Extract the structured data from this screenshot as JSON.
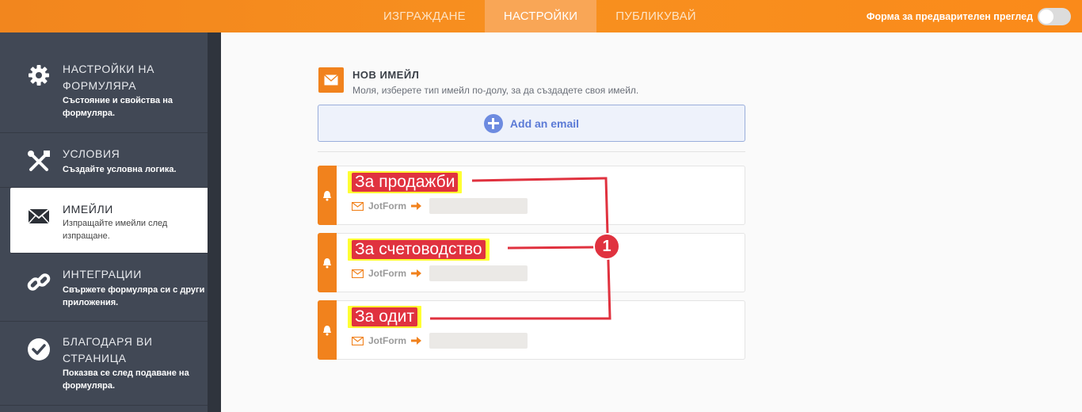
{
  "topbar": {
    "tabs": [
      {
        "label": "ИЗГРАЖДАНЕ",
        "active": false
      },
      {
        "label": "НАСТРОЙКИ",
        "active": true
      },
      {
        "label": "ПУБЛИКУВАЙ",
        "active": false
      }
    ],
    "preview_label": "Форма за предварителен преглед",
    "preview_on": false
  },
  "sidebar": {
    "items": [
      {
        "icon": "gear-icon",
        "title_line1": "НАСТРОЙКИ НА",
        "title_line2": "ФОРМУЛЯРА",
        "desc_line1": "Състояние и свойства на",
        "desc_line2": "формуляра."
      },
      {
        "icon": "tools-icon",
        "title_line1": "УСЛОВИЯ",
        "desc_line1": "Създайте условна логика."
      },
      {
        "icon": "envelope-icon",
        "title_line1": "ИМЕЙЛИ",
        "desc_line1": "Изпращайте имейли след",
        "desc_line2": "изпращане.",
        "active": true
      },
      {
        "icon": "link-icon",
        "title_line1": "ИНТЕГРАЦИИ",
        "desc_line1": "Свържете формуляра си с други",
        "desc_line2": "приложения."
      },
      {
        "icon": "check-circle-icon",
        "title_line1": "БЛАГОДАРЯ ВИ",
        "title_line2": "СТРАНИЦА",
        "desc_line1": "Показва се след подаване на",
        "desc_line2": "формуляра."
      }
    ]
  },
  "main": {
    "new_email_title": "НОВ ИМЕЙЛ",
    "new_email_subtitle": "Моля, изберете тип имейл по-долу, за да създадете своя имейл.",
    "add_button_label": "Add an email",
    "emails": [
      {
        "name": "За продажби",
        "from": "JotForm"
      },
      {
        "name": "За счетоводство",
        "from": "JotForm"
      },
      {
        "name": "За одит",
        "from": "JotForm"
      }
    ],
    "annotation_badge": "1"
  },
  "colors": {
    "accent": "#f1821d",
    "sidebar_bg": "#414855",
    "annotation_red": "#e0323f",
    "highlight_yellow": "#ffff33",
    "add_button_blue": "#5b7ad6"
  }
}
